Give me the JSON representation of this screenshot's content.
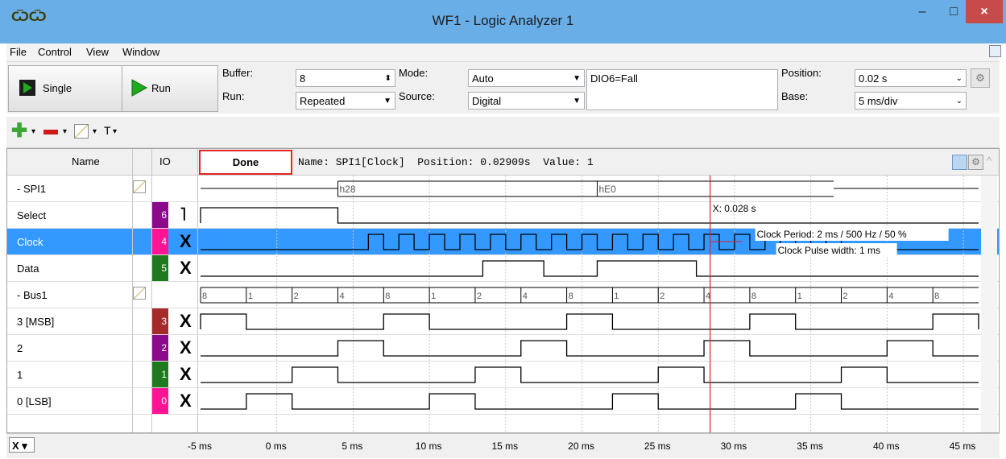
{
  "window": {
    "title": "WF1 - Logic Analyzer 1",
    "icon": "wf-app-icon",
    "controls": {
      "minimize": "–",
      "maximize": "□",
      "close": "×"
    }
  },
  "menu": [
    "File",
    "Control",
    "View",
    "Window"
  ],
  "toolbar": {
    "single_label": "Single",
    "run_label": "Run",
    "buffer_label": "Buffer:",
    "buffer_value": "8",
    "run_mode_label": "Run:",
    "run_mode_value": "Repeated",
    "mode_label": "Mode:",
    "mode_value": "Auto",
    "source_label": "Source:",
    "source_value": "Digital",
    "trigger_condition": "DIO6=Fall",
    "position_label": "Position:",
    "position_value": "0.02 s",
    "base_label": "Base:",
    "base_value": "5 ms/div",
    "add_icon": "plus-icon",
    "remove_icon": "minus-icon",
    "edit_icon": "edit-icon",
    "text_tool": "T"
  },
  "header": {
    "name_col": "Name",
    "io_col": "IO",
    "status": "Done",
    "info": "Name: SPI1[Clock]  Position: 0.02909s  Value: 1"
  },
  "signals": [
    {
      "name": "- SPI1",
      "io": "",
      "trigger": "",
      "type": "bus"
    },
    {
      "name": "Select",
      "io": "6",
      "trigger": "˥",
      "color": "#8b0a8b"
    },
    {
      "name": "Clock",
      "io": "4",
      "trigger": "X",
      "color": "#ff1493",
      "selected": true
    },
    {
      "name": "Data",
      "io": "5",
      "trigger": "X",
      "color": "#1f7a1f"
    },
    {
      "name": "- Bus1",
      "io": "",
      "trigger": "",
      "type": "bus"
    },
    {
      "name": "3 [MSB]",
      "io": "3",
      "trigger": "X",
      "color": "#a52a2a"
    },
    {
      "name": "2",
      "io": "2",
      "trigger": "X",
      "color": "#8b0a8b"
    },
    {
      "name": "1",
      "io": "1",
      "trigger": "X",
      "color": "#1f7a1f"
    },
    {
      "name": "0 [LSB]",
      "io": "0",
      "trigger": "X",
      "color": "#ff1493"
    }
  ],
  "waveform": {
    "time_start_ms": -5.0,
    "time_end_ms": 46.0,
    "spi_bus_values": [
      {
        "t": 4.0,
        "label": "h28"
      },
      {
        "t": 21.0,
        "label": "hE0"
      }
    ],
    "spi_bus_end": 36.5,
    "select_fall_ms": 4.0,
    "clock_start_ms": 6.0,
    "clock_end_ms": 36.5,
    "clock_period_ms": 2.0,
    "data_highs": [
      [
        13.5,
        17.5
      ],
      [
        21.0,
        27.5
      ]
    ],
    "bus1_values": [
      "8",
      "1",
      "2",
      "4",
      "8",
      "1",
      "2",
      "4",
      "8",
      "1",
      "2",
      "4",
      "8",
      "1",
      "2",
      "4",
      "8"
    ],
    "bus1_period_ms": 6.0,
    "cursor_ms": 28.4,
    "cursor_label": "X: 0.028 s",
    "clock_info": "Clock Period: 2 ms / 500 Hz / 50 %",
    "pulse_info": "Clock Pulse width: 1 ms",
    "ticks": [
      "-5 ms",
      "0 ms",
      "5 ms",
      "10 ms",
      "15 ms",
      "20 ms",
      "25 ms",
      "30 ms",
      "35 ms",
      "40 ms",
      "45 ms"
    ]
  },
  "footer": {
    "x_button": "X"
  }
}
